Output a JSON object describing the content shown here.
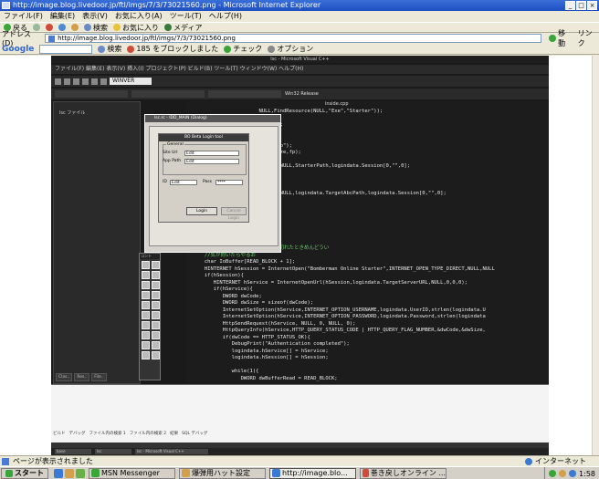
{
  "window": {
    "title": "http://image.blog.livedoor.jp/ftl/imgs/7/3/73021560.png - Microsoft Internet Explorer"
  },
  "menubar": [
    "ファイル(F)",
    "編集(E)",
    "表示(V)",
    "お気に入り(A)",
    "ツール(T)",
    "ヘルプ(H)"
  ],
  "toolbar": {
    "back": "戻る",
    "search": "検索",
    "favorites": "お気に入り",
    "media": "メディア"
  },
  "address": {
    "label": "アドレス(D)",
    "url": "http://image.blog.livedoor.jp/ftl/imgs/7/3/73021560.png",
    "go": "移動",
    "links": "リンク"
  },
  "googlebar": {
    "logo": "Google",
    "search": "検索",
    "blocked": "185 をブロックしました",
    "check": "チェック",
    "options": "オプション"
  },
  "vs": {
    "title": "lsc - Microsoft Visual C++",
    "menu": "ファイル(F) 編集(E) 表示(V) 挿入(I) プロジェクト(P) ビルド(B) ツール(T) ウィンドウ(W) ヘルプ(H)",
    "combo": "WINVER",
    "config": "Win32 Release",
    "editor_tab": "inside.cpp",
    "tree_item": "lsc ファイル",
    "panel_tabs": [
      "Clas..",
      "Res..",
      "File.."
    ],
    "palette_title": "コント",
    "output_tabs": [
      "ビルド",
      "デバッグ",
      "ファイル内の検索 1",
      "ファイル内の検索 2",
      "結果",
      "SQL デバッグ"
    ],
    "taskbar_items": [
      "base",
      "lsc",
      "lsc - Microsoft Visual C++"
    ],
    "code": [
      "                        NULL,FindResource(NULL,\"Exe\",\"Starter\"));",
      "",
      "                        erPath);",
      "                        NAME);",
      "",
      "                        Path,\"wb\");",
      "                        1,ResSize,fp);",
      "",
      "                        ainAnd,NULL,StarterPath,logindata.Session[0,\"\",0];",
      "",
      "",
      "",
      "                        ainAnd,NULL,logindata.TargetAbcPath,logindata.Session[0,\"\",0];",
      "",
      "",
      "",
      "",
      "",
      "",
      "",
      "                        と途中で切れたときめんどうい",
      "      //気が向いたらやるお",
      "      char IoBuffer[READ_BLOCK + 1];",
      "      HINTERNET hSession = InternetOpen(\"Bomberman Online Starter\",INTERNET_OPEN_TYPE_DIRECT,NULL,NULL",
      "      if(hSession){",
      "         HINTERNET hService = InternetOpenUrl(hSession,logindata.TargetServerURL,NULL,0,0,0);",
      "         if(hService){",
      "            DWORD dwCode;",
      "            DWORD dwSize = sizeof(dwCode);",
      "            InternetSetOption(hService,INTERNET_OPTION_USERNAME,logindata.UserID,strlen(logindata.U",
      "            InternetSetOption(hService,INTERNET_OPTION_PASSWORD,logindata.Password,strlen(logindata",
      "            HttpSendRequest(hService, NULL, 0, NULL, 0);",
      "            HttpQueryInfo(hService,HTTP_QUERY_STATUS_CODE | HTTP_QUERY_FLAG_NUMBER,&dwCode,&dwSize,",
      "            if(dwCode == HTTP_STATUS_OK){",
      "               DebugPrint(\"Authentication completed\");",
      "               logindata.hService[] = hService;",
      "               logindata.hSession[] = hSession;",
      "",
      "               while(1){",
      "                  DWORD dwBufferRead = READ_BLOCK;"
    ]
  },
  "dialog": {
    "title": "lsc.rc - IDD_MAIN (Dialog)",
    "login_title": "BO Beta Login tool",
    "group_label": "General",
    "site_url_label": "Site Url",
    "site_url_value": "Edit",
    "app_path_label": "App Path",
    "app_path_value": "Edit",
    "id_label": "ID",
    "id_value": "Edit",
    "pass_label": "Pass",
    "pass_value": "****",
    "login_button": "Login",
    "cancel_button": "Cancel Login"
  },
  "statusbar": {
    "text": "ページが表示されました",
    "zone": "インターネット"
  },
  "taskbar": {
    "start": "スタート",
    "tasks": [
      "MSN Messenger",
      "爆弾用ハット設定",
      "http://image.blo...",
      "巻き戻しオンライン ..."
    ],
    "clock": "1:58"
  },
  "colors": {
    "titlebar": "#1d4fc0",
    "chrome": "#ece9d8",
    "comment": "#6bd06b"
  }
}
